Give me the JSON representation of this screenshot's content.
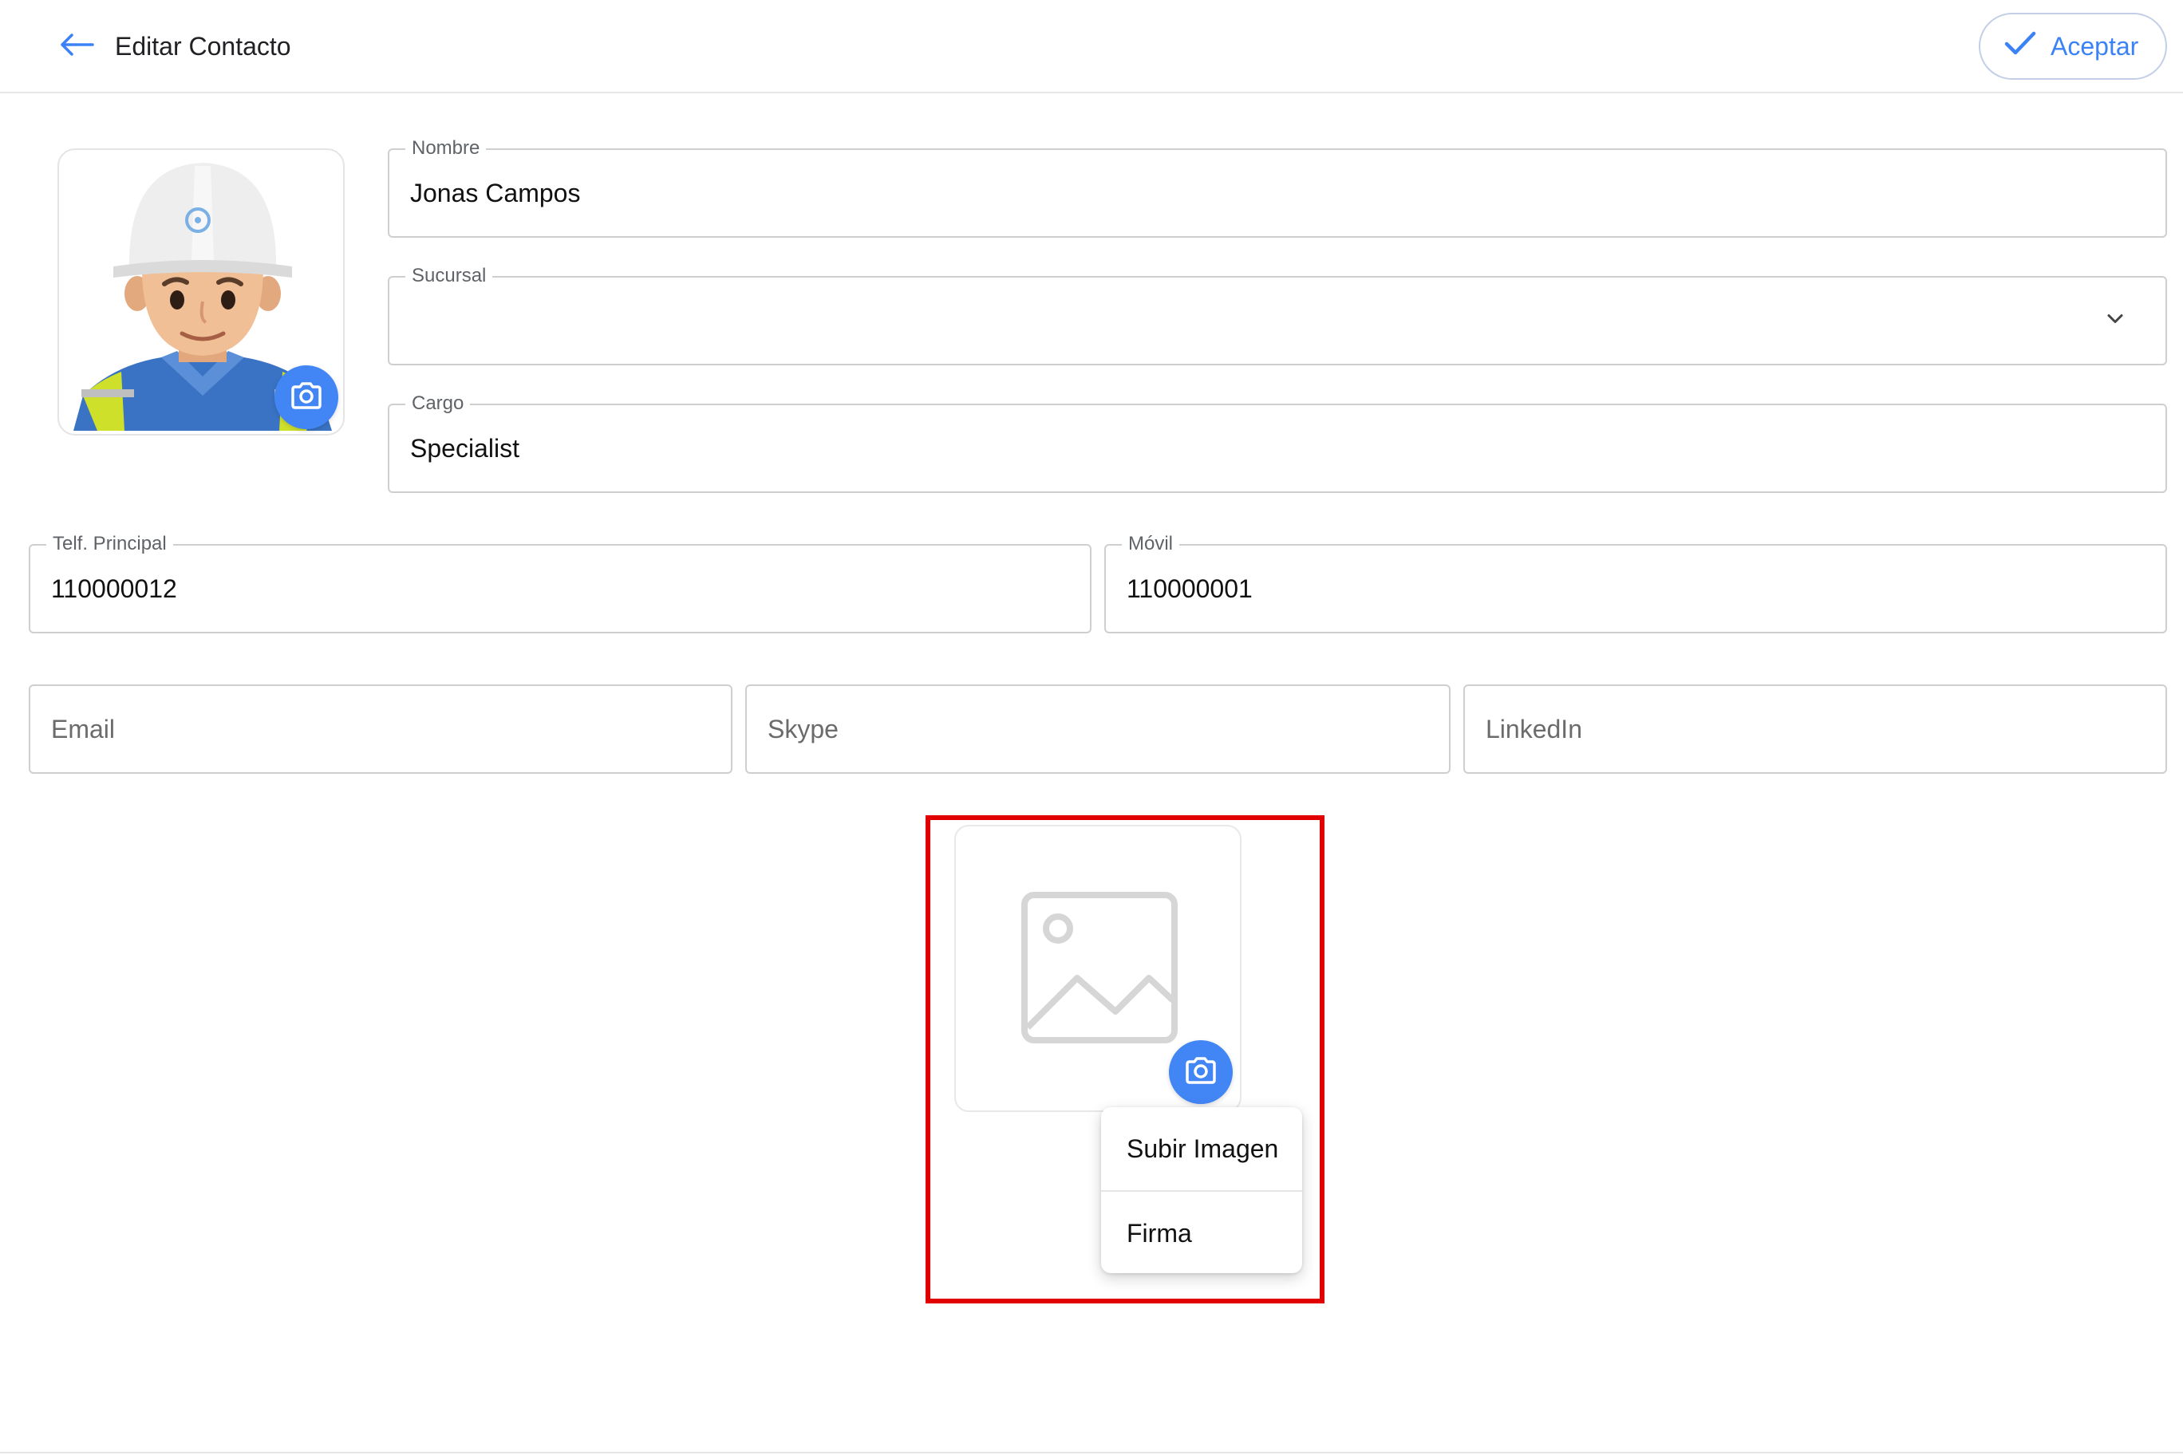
{
  "header": {
    "title": "Editar Contacto",
    "accept_label": "Aceptar"
  },
  "form": {
    "nombre": {
      "label": "Nombre",
      "value": "Jonas Campos"
    },
    "sucursal": {
      "label": "Sucursal",
      "value": ""
    },
    "cargo": {
      "label": "Cargo",
      "value": "Specialist"
    },
    "telefono": {
      "label": "Telf. Principal",
      "value": "110000012"
    },
    "movil": {
      "label": "Móvil",
      "value": "110000001"
    },
    "email": {
      "placeholder": "Email"
    },
    "skype": {
      "placeholder": "Skype"
    },
    "linkedin": {
      "placeholder": "LinkedIn"
    }
  },
  "image_menu": {
    "items": [
      {
        "label": "Subir Imagen"
      },
      {
        "label": "Firma"
      }
    ]
  },
  "icons": {
    "back": "arrow-left-icon",
    "accept": "check-icon",
    "camera": "camera-icon",
    "dropdown": "chevron-down-icon",
    "image": "image-placeholder-icon"
  },
  "colors": {
    "accent": "#4285f4",
    "highlight": "#e00000"
  }
}
